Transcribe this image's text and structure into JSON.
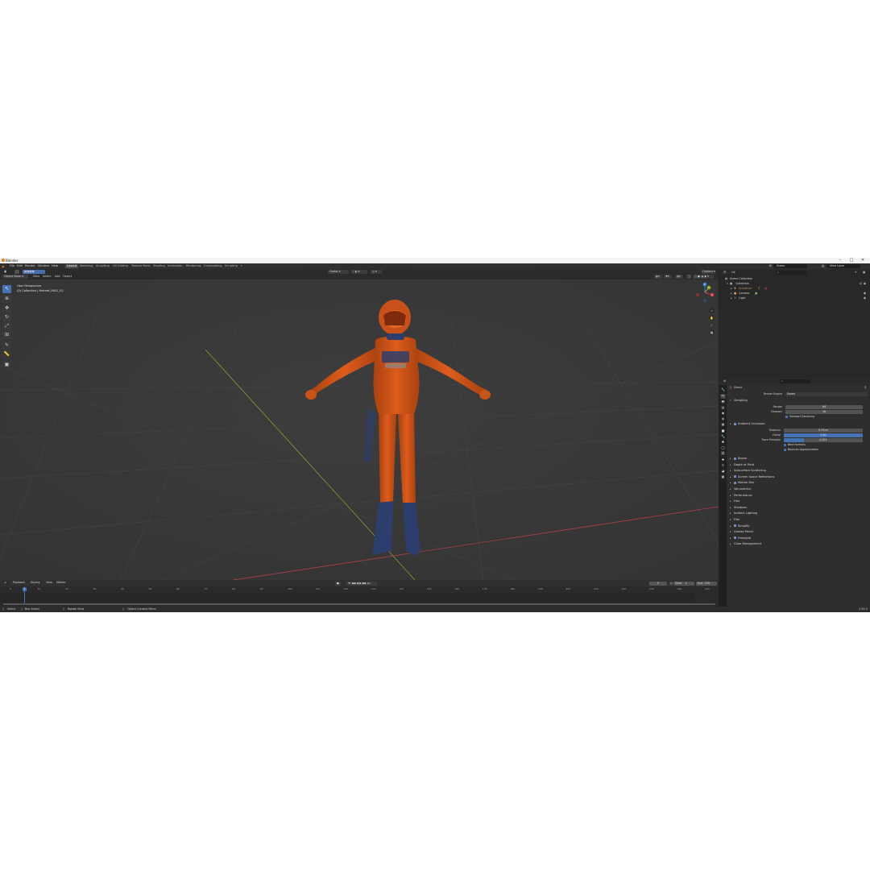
{
  "window": {
    "title": "Blender",
    "min": "–",
    "max": "□",
    "close": "✕"
  },
  "menu": [
    "File",
    "Edit",
    "Render",
    "Window",
    "Help"
  ],
  "workspaces": [
    "Layout",
    "Modeling",
    "Sculpting",
    "UV Editing",
    "Texture Paint",
    "Shading",
    "Animation",
    "Rendering",
    "Compositing",
    "Scripting"
  ],
  "workspace_add": "+",
  "topbar": {
    "scene": "Scene",
    "view_layer": "View Layer"
  },
  "viewport": {
    "mode": "Object Mode",
    "menus": [
      "View",
      "Select",
      "Add",
      "Object"
    ],
    "transform": "Global",
    "options": "Options",
    "overlay_line1": "User Perspective",
    "overlay_line2": "(0) Collection | Helmet_FA01_V2",
    "axis_x": "X",
    "axis_y": "Y",
    "axis_z": "Z"
  },
  "timeline": {
    "menus": [
      "Playback",
      "Keying",
      "View",
      "Marker"
    ],
    "current_frame": "1",
    "start_label": "Start",
    "start": "1",
    "end_label": "End",
    "end": "250",
    "frame_field": "0",
    "ticks": [
      "0",
      "10",
      "20",
      "30",
      "40",
      "50",
      "60",
      "70",
      "80",
      "90",
      "100",
      "110",
      "120",
      "130",
      "140",
      "150",
      "160",
      "170",
      "180",
      "190",
      "200",
      "210",
      "220",
      "230",
      "240",
      "250"
    ]
  },
  "status": {
    "select": "Select",
    "box_select": "Box Select",
    "rotate_view": "Rotate View",
    "context_menu": "Object Context Menu",
    "version": "2.92.0"
  },
  "outliner": {
    "search_placeholder": "",
    "root": "Scene Collection",
    "collection": "Collection",
    "items": [
      "Armature",
      "Camera",
      "Light"
    ]
  },
  "properties": {
    "scene": "Scene",
    "render_engine_label": "Render Engine",
    "render_engine": "Eevee",
    "sampling": "Sampling",
    "render_label": "Render",
    "render": "64",
    "viewport_label": "Viewport",
    "viewport": "16",
    "viewport_denoising": "Viewport Denoising",
    "ao": "Ambient Occlusion",
    "distance_label": "Distance",
    "distance": "0.75 m",
    "factor_label": "Factor",
    "factor": "1.00",
    "factor_fill": 1.0,
    "trace_precision_label": "Trace Precision",
    "trace_precision": "0.251",
    "trace_precision_fill": 0.25,
    "bent_normals": "Bent Normals",
    "bounces_approx": "Bounces Approximation",
    "panels": [
      "Bloom",
      "Depth of Field",
      "Subsurface Scattering",
      "Screen Space Reflections",
      "Motion Blur",
      "Volumetrics",
      "Performance",
      "Hair",
      "Shadows",
      "Indirect Lighting",
      "Film",
      "Simplify",
      "Grease Pencil",
      "Freestyle",
      "Color Management"
    ],
    "panels_checkbox": [
      true,
      false,
      false,
      true,
      true,
      false,
      false,
      false,
      false,
      false,
      false,
      true,
      false,
      true,
      false
    ]
  },
  "colors": {
    "suit": "#d4541b",
    "suit_dark": "#8e2f0e",
    "blue_accent": "#2c3e6b",
    "selection": "#4772b3",
    "x_axis": "#c0414b",
    "y_axis": "#8cab2e",
    "z_axis": "#3c7fd8"
  }
}
